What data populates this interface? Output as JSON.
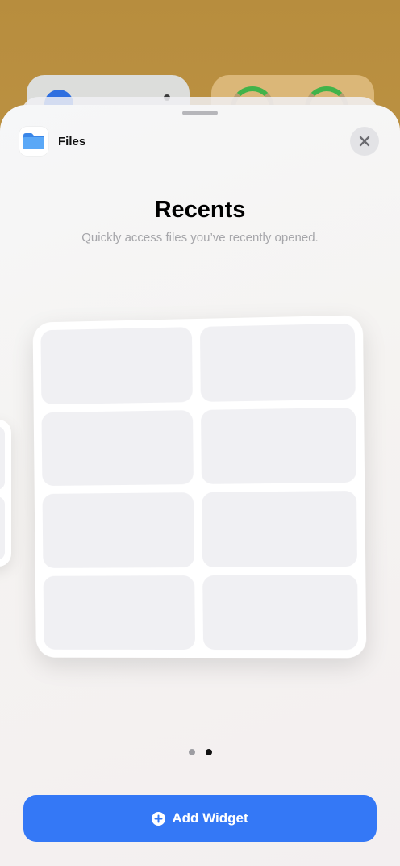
{
  "app": {
    "name": "Files",
    "icon": "folder-icon"
  },
  "widget": {
    "title": "Recents",
    "subtitle": "Quickly access files you’ve recently opened."
  },
  "pagination": {
    "total": 2,
    "current": 2
  },
  "actions": {
    "close_icon": "close-icon",
    "add_widget_label": "Add Widget",
    "add_widget_icon": "plus-circle-icon"
  },
  "colors": {
    "accent": "#3478f6",
    "folder": "#4a9cf5",
    "ring": "#41b34a"
  }
}
